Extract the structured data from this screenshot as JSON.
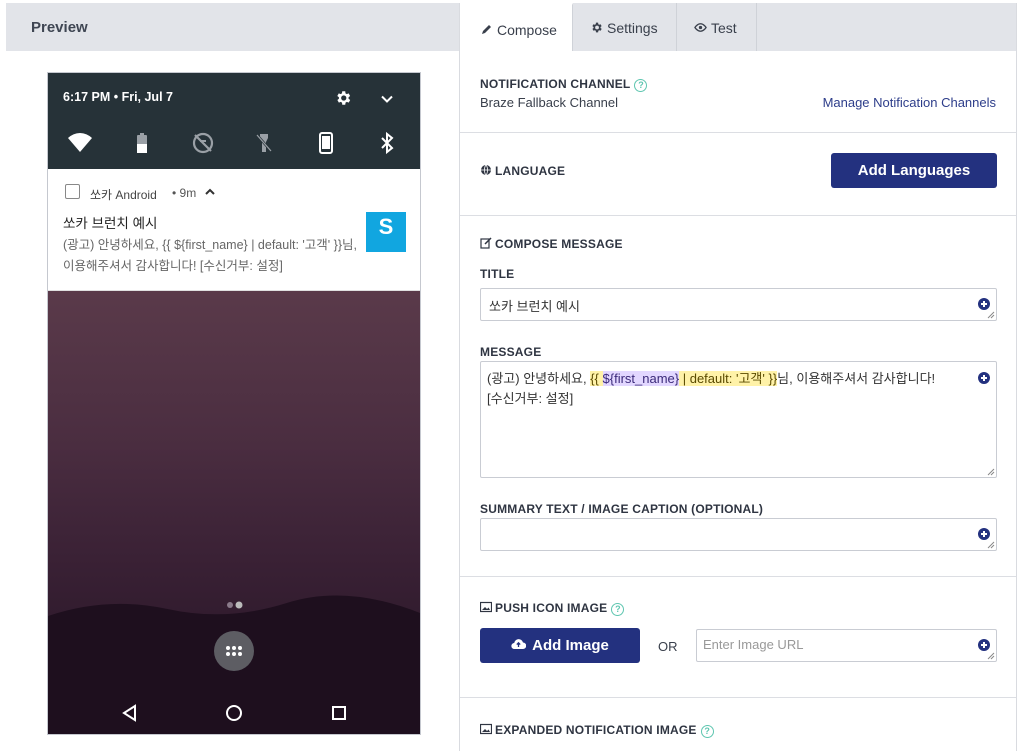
{
  "preview": {
    "header": "Preview",
    "status_bar": {
      "time": "6:17 PM • Fri, Jul 7"
    },
    "notification": {
      "app_name": "쏘카 Android",
      "time": "• 9m",
      "title": "쏘카 브런치 예시",
      "body": "(광고) 안녕하세요, {{ ${first_name} | default: '고객' }}님, 이용해주셔서 감사합니다! [수신거부: 설정]",
      "thumb_letter": "S"
    }
  },
  "tabs": [
    {
      "label": "Compose",
      "icon": "pencil-icon",
      "active": true
    },
    {
      "label": "Settings",
      "icon": "gear-icon",
      "active": false
    },
    {
      "label": "Test",
      "icon": "eye-icon",
      "active": false
    }
  ],
  "channel": {
    "label": "NOTIFICATION CHANNEL",
    "value": "Braze Fallback Channel",
    "manage_link": "Manage Notification Channels"
  },
  "language": {
    "label": "LANGUAGE",
    "button": "Add Languages"
  },
  "compose": {
    "label": "COMPOSE MESSAGE",
    "title_label": "TITLE",
    "title_value": "쏘카 브런치 예시",
    "message_label": "MESSAGE",
    "message_prefix": "(광고) 안녕하세요, ",
    "message_liquid_open": "{{ ",
    "message_liquid_var": "${first_name}",
    "message_liquid_rest": " | default: '고객' }}",
    "message_suffix": "님, 이용해주셔서 감사합니다!",
    "message_line2": "[수신거부: 설정]",
    "summary_label": "SUMMARY TEXT / IMAGE CAPTION (OPTIONAL)",
    "summary_value": ""
  },
  "push_icon": {
    "label": "PUSH ICON IMAGE",
    "button": "Add Image",
    "or": "OR",
    "url_placeholder": "Enter Image URL"
  },
  "expanded": {
    "label": "EXPANDED NOTIFICATION IMAGE"
  },
  "colors": {
    "primary": "#23317f",
    "help": "#5fc6b0",
    "panel_header": "#e2e4e9",
    "statusbar": "#263238"
  }
}
